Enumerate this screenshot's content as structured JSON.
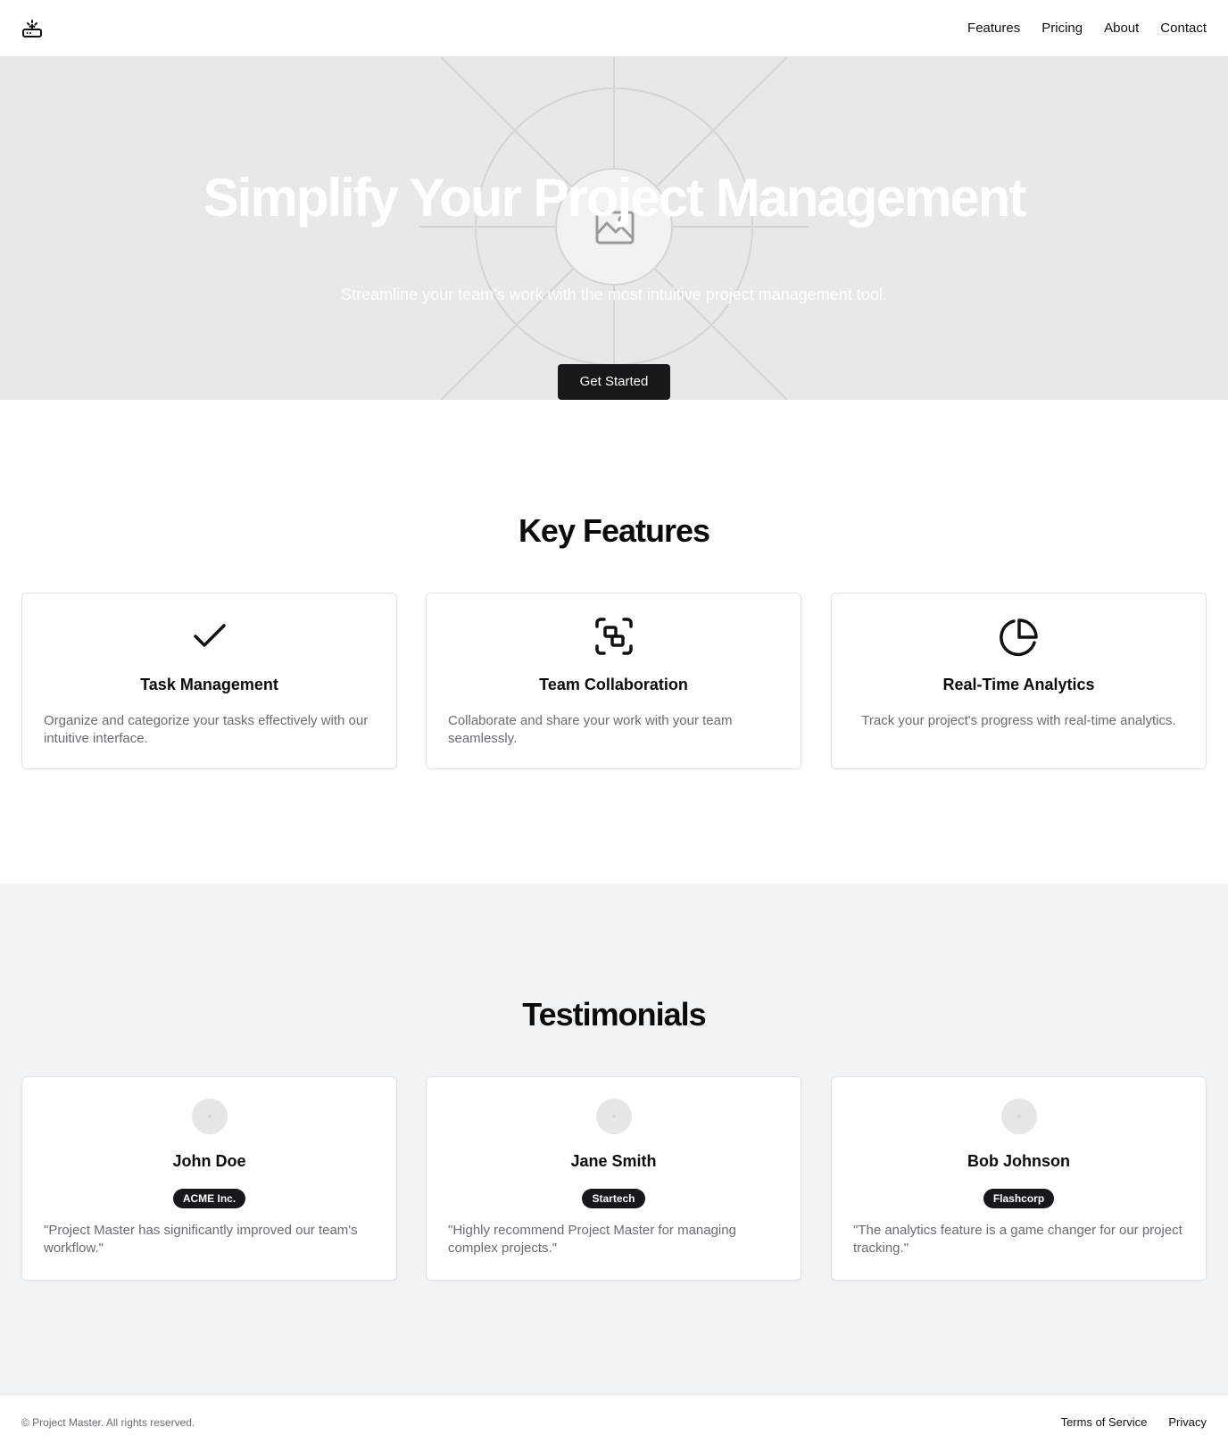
{
  "header": {
    "logo_icon": "router-icon",
    "nav": [
      "Features",
      "Pricing",
      "About",
      "Contact"
    ]
  },
  "hero": {
    "title": "Simplify Your Project Management",
    "subtitle": "Streamline your team's work with the most intuitive project management tool.",
    "cta": "Get Started",
    "image_icon": "image-placeholder-icon"
  },
  "features": {
    "title": "Key Features",
    "items": [
      {
        "icon": "check-icon",
        "title": "Task Management",
        "description": "Organize and categorize your tasks effectively with our intuitive interface."
      },
      {
        "icon": "group-icon",
        "title": "Team Collaboration",
        "description": "Collaborate and share your work with your team seamlessly."
      },
      {
        "icon": "pie-chart-icon",
        "title": "Real-Time Analytics",
        "description": "Track your project's progress with real-time analytics."
      }
    ]
  },
  "testimonials": {
    "title": "Testimonials",
    "items": [
      {
        "name": "John Doe",
        "company": "ACME Inc.",
        "quote": "\"Project Master has significantly improved our team's workflow.\""
      },
      {
        "name": "Jane Smith",
        "company": "Startech",
        "quote": "\"Highly recommend Project Master for managing complex projects.\""
      },
      {
        "name": "Bob Johnson",
        "company": "Flashcorp",
        "quote": "\"The analytics feature is a game changer for our project tracking.\""
      }
    ]
  },
  "footer": {
    "copyright": "© Project Master. All rights reserved.",
    "links": [
      "Terms of Service",
      "Privacy"
    ]
  },
  "colors": {
    "hero_bg": "#e8e8e8",
    "button_bg": "#18181b",
    "section_alt_bg": "#f2f3f5",
    "muted_text": "#6b6b73"
  }
}
